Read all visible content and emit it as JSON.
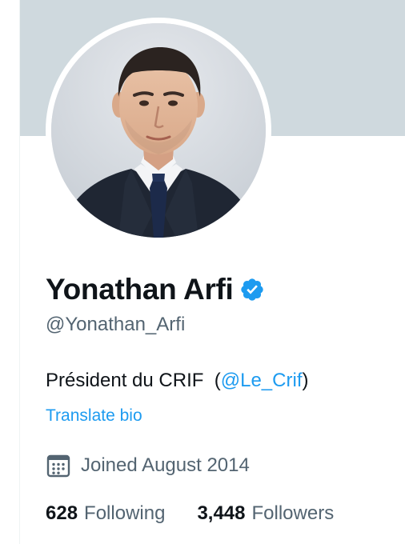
{
  "profile": {
    "display_name": "Yonathan Arfi",
    "verified": true,
    "handle": "@Yonathan_Arfi",
    "bio_text": "Président du CRIF  (",
    "bio_mention": "@Le_Crif",
    "bio_suffix": ")",
    "translate_label": "Translate bio",
    "joined_text": "Joined August 2014",
    "following_count": "628",
    "following_label": "Following",
    "followers_count": "3,448",
    "followers_label": "Followers"
  },
  "icons": {
    "verified": "verified-badge-icon",
    "calendar": "calendar-icon"
  },
  "colors": {
    "accent": "#1d9bf0",
    "banner": "#cfd9de",
    "primary_text": "#0f1419",
    "secondary_text": "#536471"
  }
}
